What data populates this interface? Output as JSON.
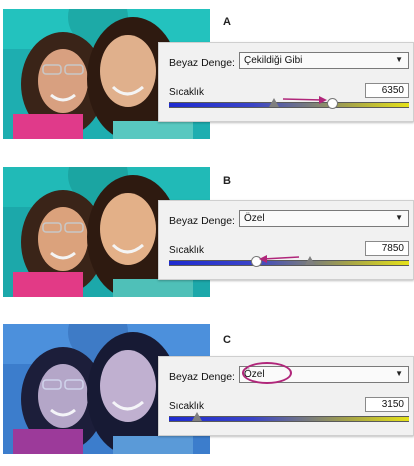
{
  "colors": {
    "accent_magenta": "#b0267a",
    "teal_bg": "#1fb8b4",
    "blue_bg": "#3f7fd0"
  },
  "panels": [
    {
      "letter": "A",
      "white_balance_label": "Beyaz Denge:",
      "white_balance_value": "Çekildiği Gibi",
      "temperature_label": "Sıcaklık",
      "temperature_value": "6350"
    },
    {
      "letter": "B",
      "white_balance_label": "Beyaz Denge:",
      "white_balance_value": "Özel",
      "temperature_label": "Sıcaklık",
      "temperature_value": "7850"
    },
    {
      "letter": "C",
      "white_balance_label": "Beyaz Denge:",
      "white_balance_value": "Özel",
      "temperature_label": "Sıcaklık",
      "temperature_value": "3150"
    }
  ]
}
